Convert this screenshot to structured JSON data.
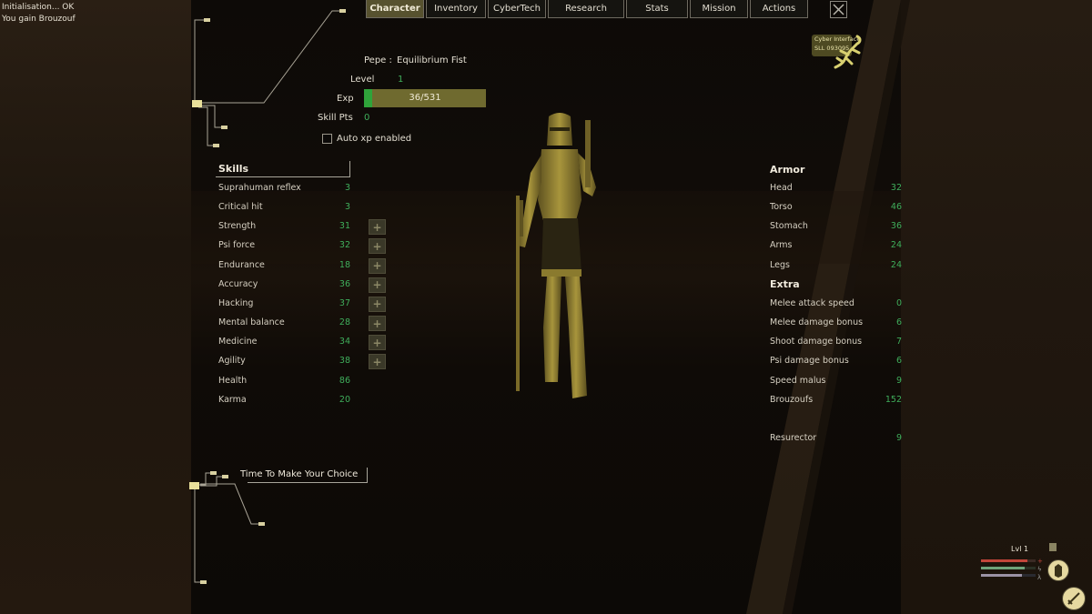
{
  "console": {
    "lines": [
      "Initialisation... OK",
      "You gain Brouzouf"
    ]
  },
  "tabs": [
    {
      "label": "Character",
      "active": true
    },
    {
      "label": "Inventory",
      "active": false
    },
    {
      "label": "CyberTech",
      "active": false
    },
    {
      "label": "Research",
      "active": false
    },
    {
      "label": "Stats",
      "active": false
    },
    {
      "label": "Mission",
      "active": false
    },
    {
      "label": "Actions",
      "active": false
    }
  ],
  "character": {
    "name": "Pepe :",
    "fighting_style": "Equilibrium Fist",
    "level_label": "Level",
    "level": "1",
    "exp_label": "Exp",
    "exp_text": "36/531",
    "exp_fraction": 0.068,
    "skill_pts_label": "Skill Pts",
    "skill_pts": "0",
    "auto_xp_label": "Auto xp enabled",
    "auto_xp_checked": false
  },
  "cyber_interface": {
    "line1": "Cyber Interface",
    "line2": "SLL 093095"
  },
  "skills": {
    "title": "Skills",
    "items": [
      {
        "label": "Suprahuman reflex",
        "value": "3",
        "upgradable": false
      },
      {
        "label": "Critical hit",
        "value": "3",
        "upgradable": false
      },
      {
        "label": "Strength",
        "value": "31",
        "upgradable": true
      },
      {
        "label": "Psi force",
        "value": "32",
        "upgradable": true
      },
      {
        "label": "Endurance",
        "value": "18",
        "upgradable": true
      },
      {
        "label": "Accuracy",
        "value": "36",
        "upgradable": true
      },
      {
        "label": "Hacking",
        "value": "37",
        "upgradable": true
      },
      {
        "label": "Mental balance",
        "value": "28",
        "upgradable": true
      },
      {
        "label": "Medicine",
        "value": "34",
        "upgradable": true
      },
      {
        "label": "Agility",
        "value": "38",
        "upgradable": true
      },
      {
        "label": "Health",
        "value": "86",
        "upgradable": false
      },
      {
        "label": "Karma",
        "value": "20",
        "upgradable": false
      }
    ]
  },
  "armor": {
    "title": "Armor",
    "items": [
      {
        "label": "Head",
        "value": "32"
      },
      {
        "label": "Torso",
        "value": "46"
      },
      {
        "label": "Stomach",
        "value": "36"
      },
      {
        "label": "Arms",
        "value": "24"
      },
      {
        "label": "Legs",
        "value": "24"
      }
    ]
  },
  "extra": {
    "title": "Extra",
    "items": [
      {
        "label": "Melee attack speed",
        "value": "0"
      },
      {
        "label": "Melee damage bonus",
        "value": "6"
      },
      {
        "label": "Shoot damage bonus",
        "value": "7"
      },
      {
        "label": "Psi damage bonus",
        "value": "6"
      },
      {
        "label": "Speed malus",
        "value": "9"
      },
      {
        "label": "Brouzoufs",
        "value": "152"
      }
    ],
    "resurrector_label": "Resurector",
    "resurrector_value": "9"
  },
  "choice": {
    "label": "Time To Make Your Choice"
  },
  "hud": {
    "level_text": "Lvl 1",
    "health_fraction": 0.85,
    "energy_fraction": 0.8,
    "stamina_fraction": 0.75
  },
  "colors": {
    "accent": "#57522f",
    "value_green": "#3fae5b",
    "exp_bar": "#6f6a2f",
    "exp_fill": "#2fa33a",
    "armor_gold": "#8a7a2e"
  }
}
